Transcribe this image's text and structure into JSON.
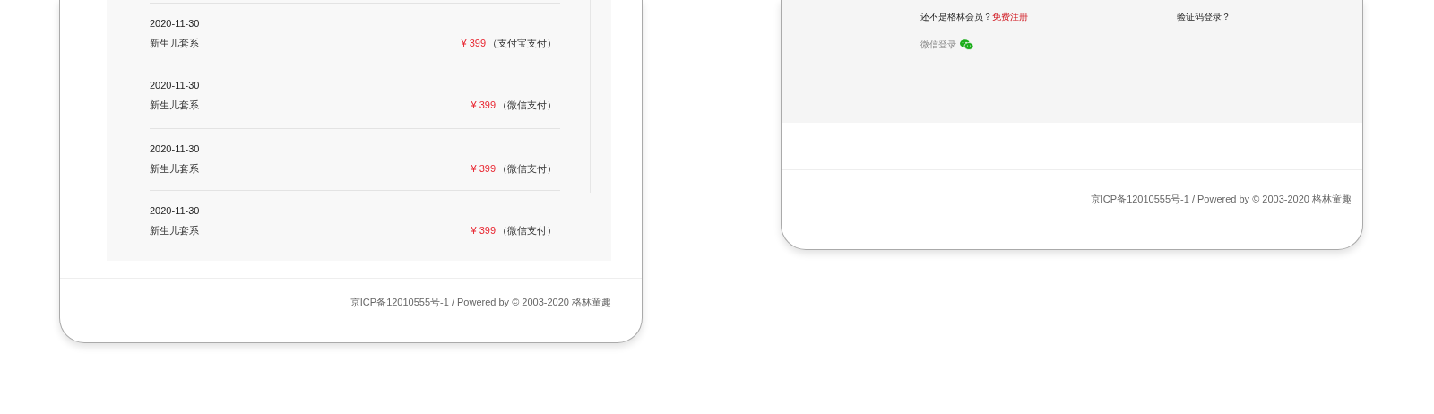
{
  "orders_card": {
    "orders": [
      {
        "date": "2020-11-30",
        "name": "新生儿套系",
        "price": "¥ 399",
        "payment": "（支付宝支付）"
      },
      {
        "date": "2020-11-30",
        "name": "新生儿套系",
        "price": "¥ 399",
        "payment": "（微信支付）"
      },
      {
        "date": "2020-11-30",
        "name": "新生儿套系",
        "price": "¥ 399",
        "payment": "（微信支付）"
      },
      {
        "date": "2020-11-30",
        "name": "新生儿套系",
        "price": "¥ 399",
        "payment": "（微信支付）"
      }
    ],
    "footer": "京ICP备12010555号-1 / Powered by © 2003-2020 格林童趣"
  },
  "login_card": {
    "register_prompt": "还不是格林会员？",
    "register_link": "免费注册",
    "code_login": "验证码登录？",
    "wechat_login": "微信登录",
    "footer": "京ICP备12010555号-1 / Powered by © 2003-2020 格林童趣"
  }
}
